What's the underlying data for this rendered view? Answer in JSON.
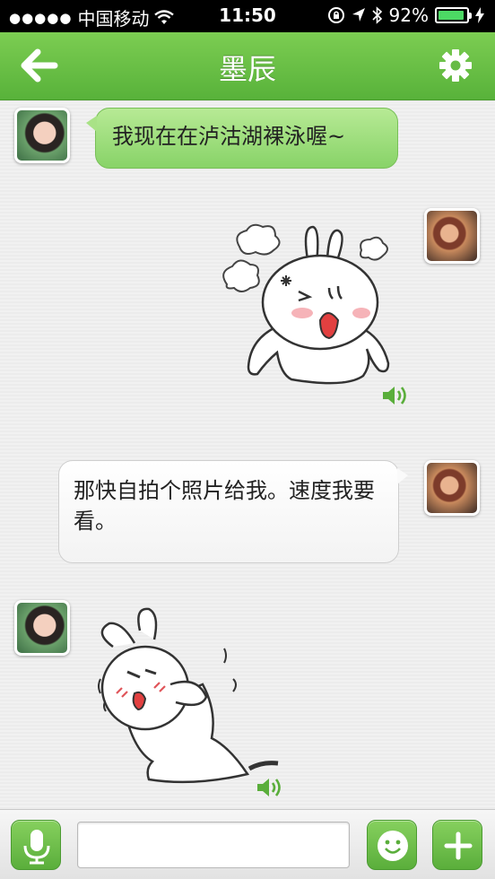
{
  "status_bar": {
    "carrier": "中国移动",
    "signal_dots": "●●●●●",
    "time": "11:50",
    "battery_percent": "92%",
    "battery_level": 0.92
  },
  "header": {
    "title": "墨辰",
    "back_icon": "arrow-left-icon",
    "settings_icon": "gear-icon"
  },
  "messages": [
    {
      "sender": "contact",
      "type": "text",
      "text": "我现在在泸沽湖裸泳喔~"
    },
    {
      "sender": "me",
      "type": "sticker",
      "sticker": "angry-rabbit"
    },
    {
      "sender": "me",
      "type": "text",
      "text": "那快自拍个照片给我。速度我要看。"
    },
    {
      "sender": "contact",
      "type": "sticker",
      "sticker": "shy-rabbit"
    }
  ],
  "input_bar": {
    "voice_icon": "microphone-icon",
    "input_value": "",
    "emoji_icon": "smiley-icon",
    "more_icon": "plus-icon"
  },
  "colors": {
    "accent_green": "#6cc047",
    "incoming_bubble": "#a9e286",
    "outgoing_bubble": "#ffffff"
  }
}
